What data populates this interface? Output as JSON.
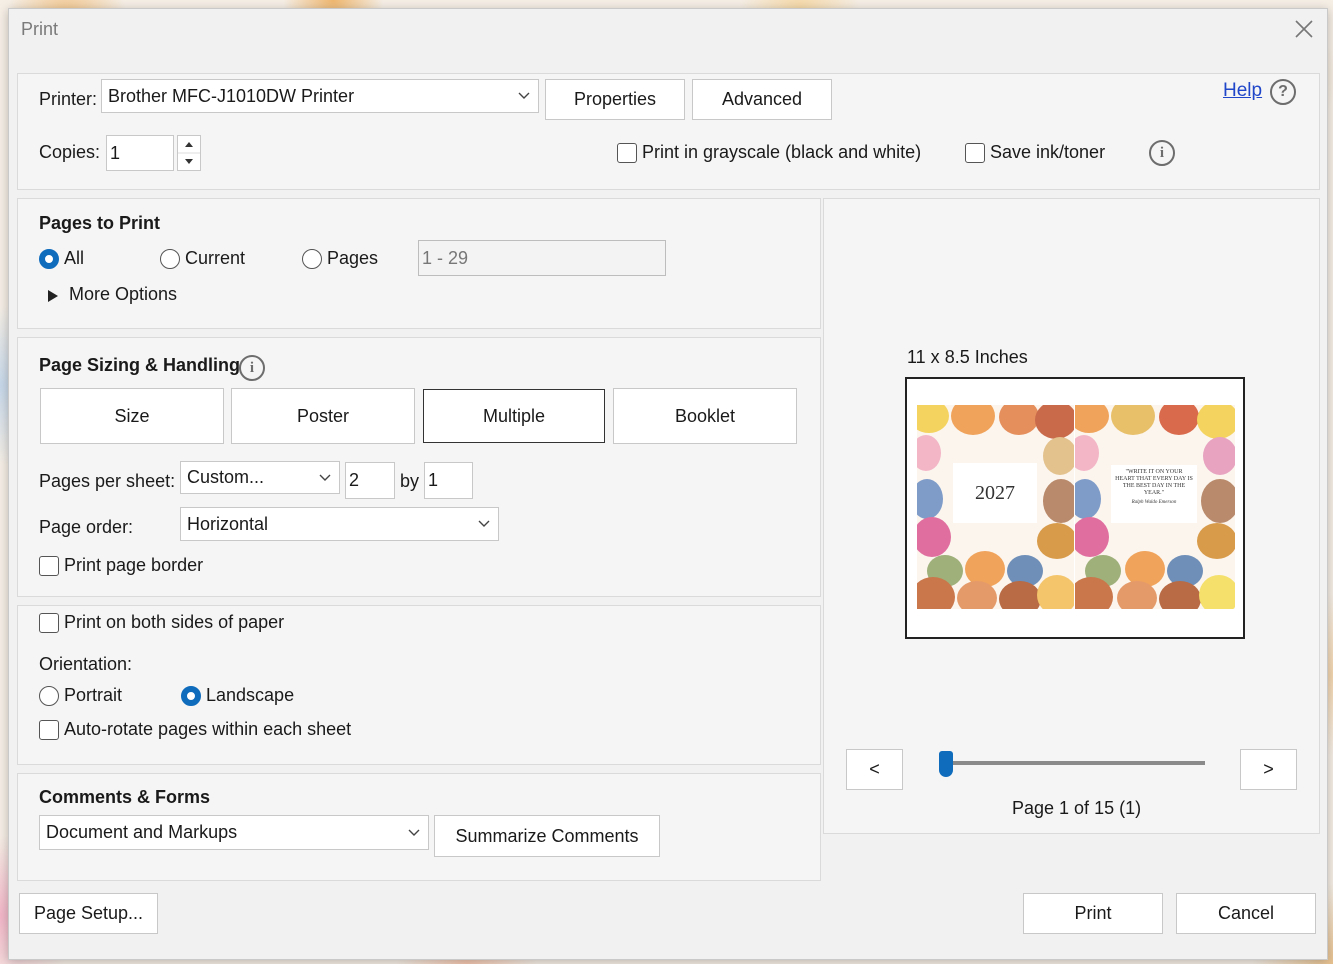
{
  "dialog": {
    "title": "Print"
  },
  "printer": {
    "label": "Printer:",
    "value": "Brother MFC-J1010DW Printer",
    "properties_label": "Properties",
    "advanced_label": "Advanced",
    "help_label": "Help"
  },
  "copies": {
    "label": "Copies:",
    "value": "1"
  },
  "options": {
    "grayscale_label": "Print in grayscale (black and white)",
    "save_ink_label": "Save ink/toner"
  },
  "pages_to_print": {
    "heading": "Pages to Print",
    "all_label": "All",
    "current_label": "Current",
    "pages_label": "Pages",
    "pages_range": "1 - 29",
    "more_options_label": "More Options",
    "selected": "All"
  },
  "sizing": {
    "heading": "Page Sizing & Handling",
    "tabs": [
      "Size",
      "Poster",
      "Multiple",
      "Booklet"
    ],
    "active_tab": "Multiple",
    "pages_per_sheet_label": "Pages per sheet:",
    "pages_per_sheet_value": "Custom...",
    "cols_value": "2",
    "by_label": "by",
    "rows_value": "1",
    "page_order_label": "Page order:",
    "page_order_value": "Horizontal",
    "print_border_label": "Print page border"
  },
  "duplex": {
    "both_sides_label": "Print on both sides of paper",
    "orientation_label": "Orientation:",
    "portrait_label": "Portrait",
    "landscape_label": "Landscape",
    "selected": "Landscape",
    "auto_rotate_label": "Auto-rotate pages within each sheet"
  },
  "comments": {
    "heading": "Comments & Forms",
    "value": "Document and Markups",
    "summarize_label": "Summarize Comments"
  },
  "preview": {
    "size_label": "11 x 8.5 Inches",
    "page_info": "Page 1 of 15 (1)",
    "prev_label": "<",
    "next_label": ">",
    "slider_position": 0,
    "left_page_text": "2027",
    "right_page_quote": "\"WRITE IT ON YOUR HEART THAT EVERY DAY IS THE BEST DAY IN THE YEAR.\"",
    "right_page_author": "Ralph Waldo Emerson"
  },
  "footer": {
    "page_setup_label": "Page Setup...",
    "print_label": "Print",
    "cancel_label": "Cancel"
  },
  "colors": {
    "accent": "#0f6cbd",
    "link": "#1f45c8",
    "dialog_bg": "#f1f1f1"
  }
}
